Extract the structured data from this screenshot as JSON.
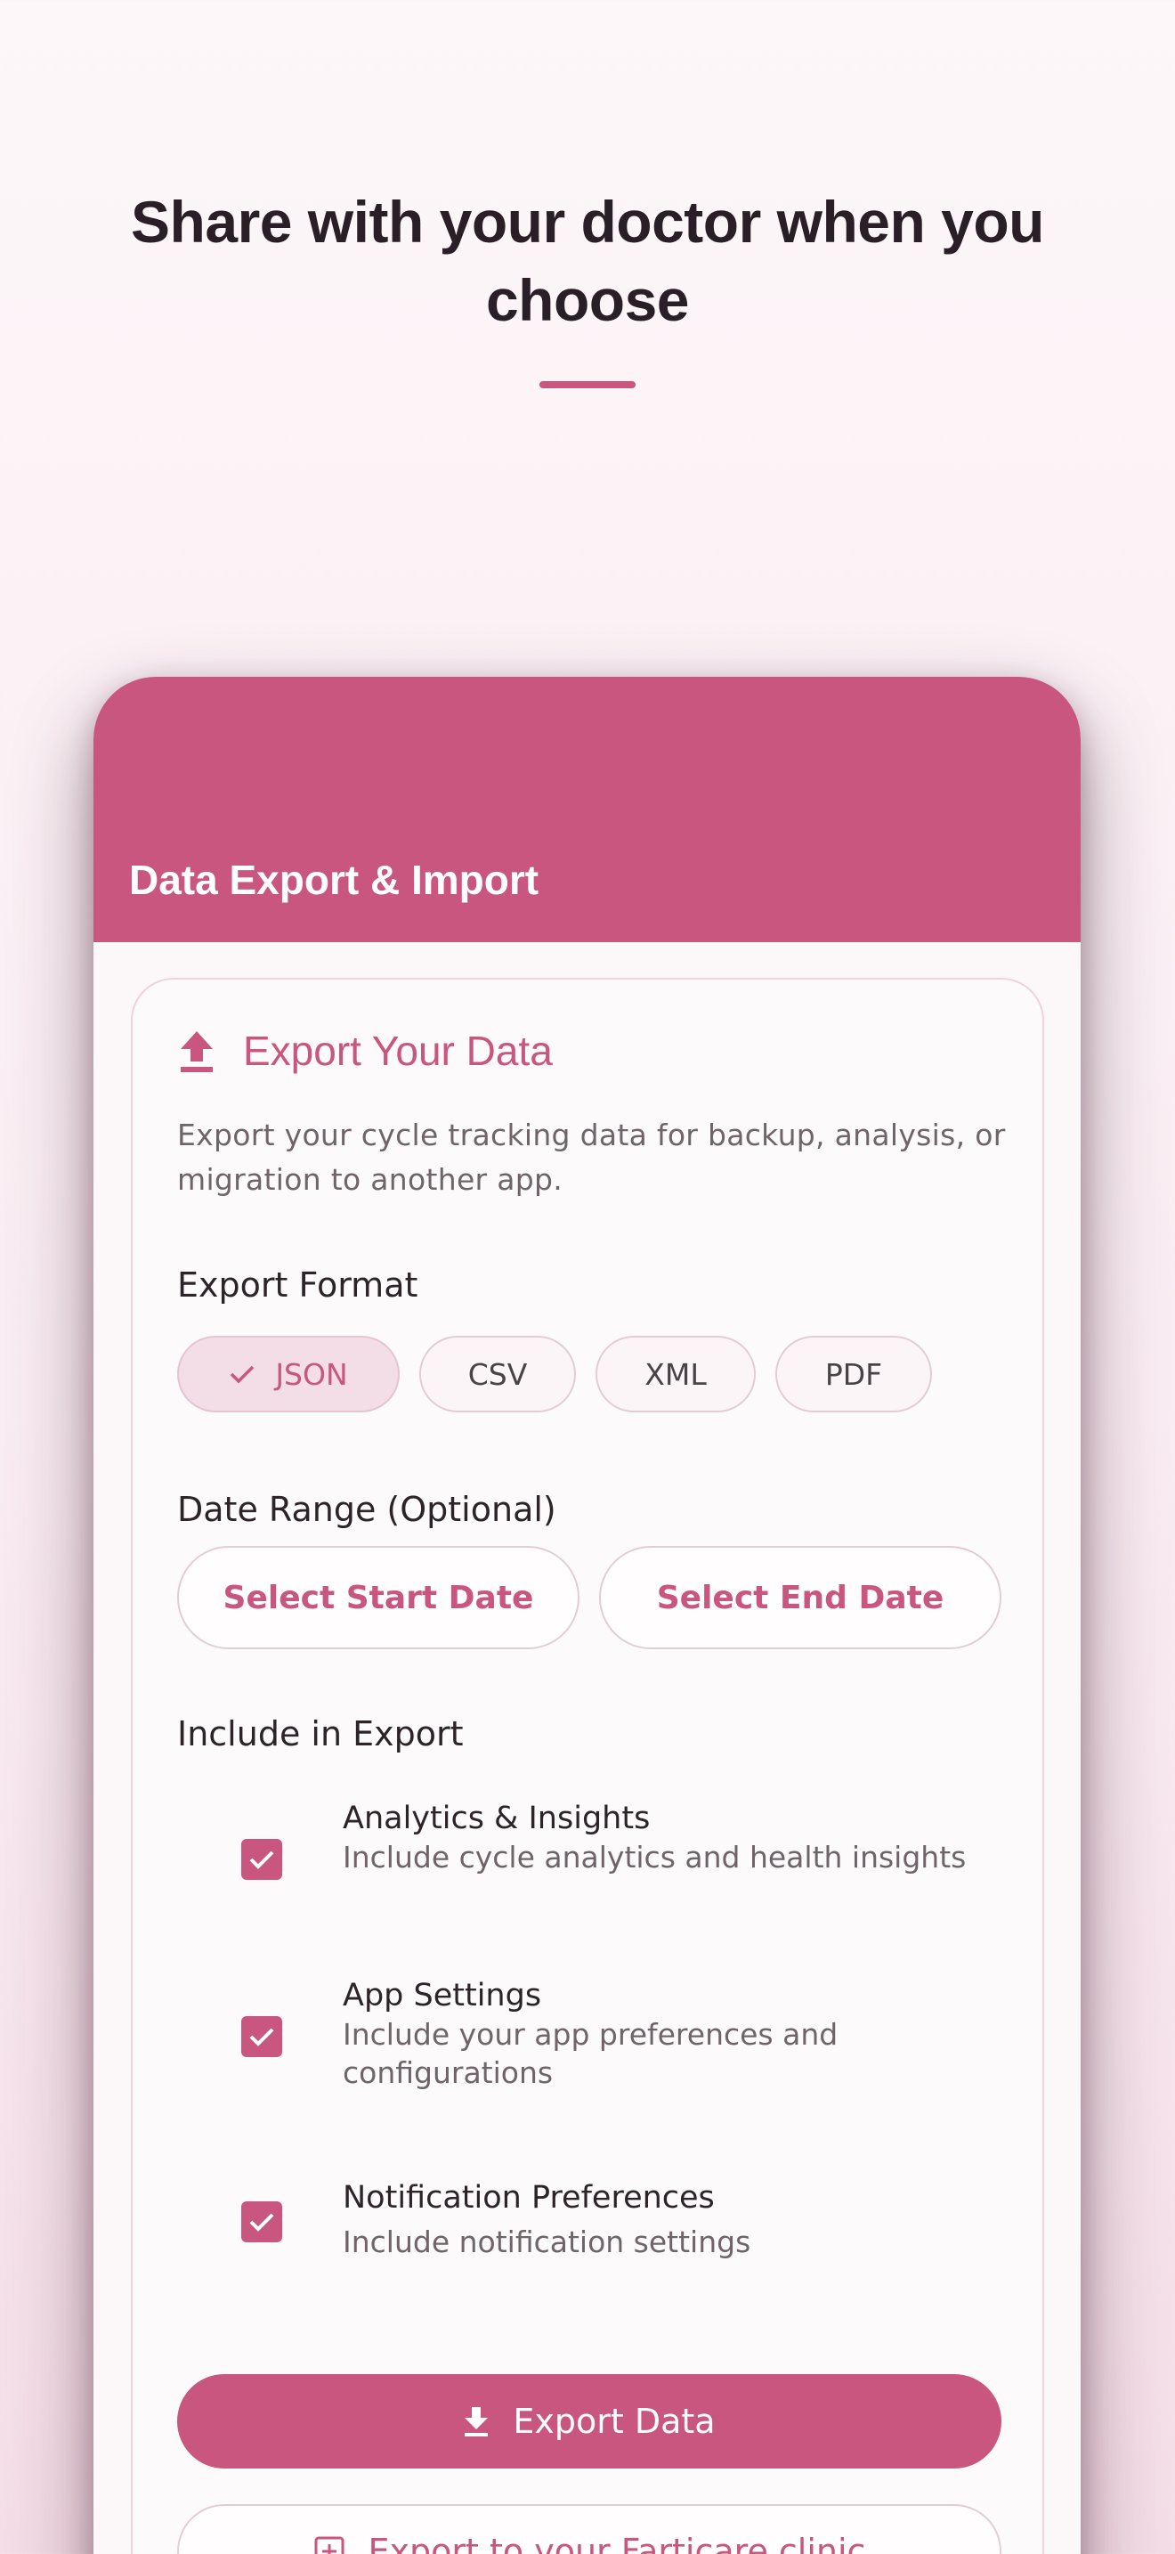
{
  "hero": {
    "title": "Share with your doctor when you choose"
  },
  "appbar": {
    "title": "Data Export & Import"
  },
  "export_section": {
    "title": "Export Your Data",
    "icon": "upload-icon",
    "description": "Export your cycle tracking data for backup, analysis, or migration to another app."
  },
  "format": {
    "label": "Export Format",
    "options": [
      "JSON",
      "CSV",
      "XML",
      "PDF"
    ],
    "selected": "JSON"
  },
  "date_range": {
    "label": "Date Range (Optional)",
    "start_label": "Select Start Date",
    "end_label": "Select End Date"
  },
  "include": {
    "label": "Include in Export",
    "items": [
      {
        "title": "Analytics & Insights",
        "subtitle": "Include cycle analytics and health insights",
        "checked": true
      },
      {
        "title": "App Settings",
        "subtitle": "Include your app preferences and configurations",
        "checked": true
      },
      {
        "title": "Notification Preferences",
        "subtitle": "Include notification settings",
        "checked": true
      }
    ]
  },
  "actions": {
    "export_label": "Export Data",
    "clinic_label": "Export to your Farticare clinic"
  },
  "colors": {
    "accent": "#c8567e",
    "chip_selected_bg": "#f3dde6"
  }
}
